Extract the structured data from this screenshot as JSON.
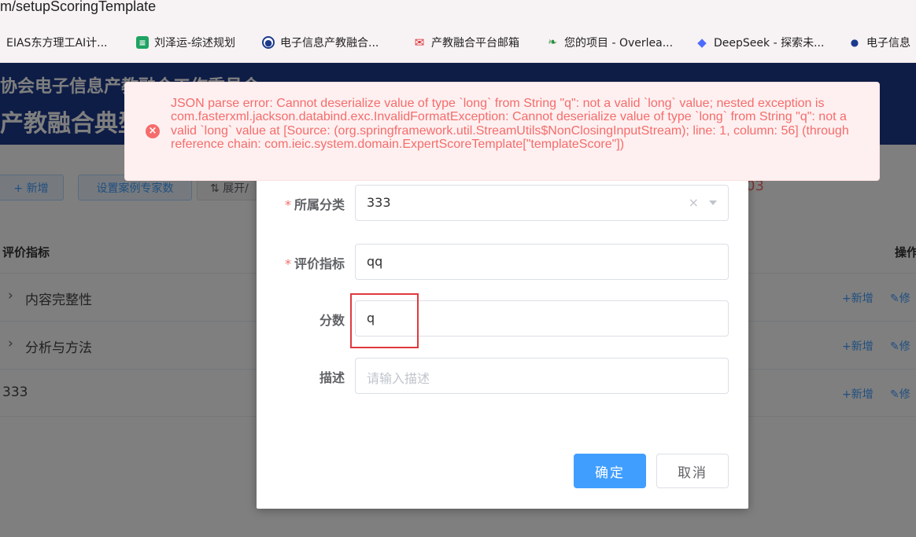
{
  "browser": {
    "url": "m/setupScoringTemplate",
    "bookmarks": [
      {
        "label": "EIAS东方理工AI计...",
        "icon": "page-icon"
      },
      {
        "label": "刘泽运-综述规划",
        "icon": "sheets-icon"
      },
      {
        "label": "电子信息产教融合...",
        "icon": "emblem-icon"
      },
      {
        "label": "产教融合平台邮箱",
        "icon": "mail-icon"
      },
      {
        "label": "您的项目 - Overlea...",
        "icon": "overleaf-icon"
      },
      {
        "label": "DeepSeek - 探索未...",
        "icon": "deepseek-icon"
      },
      {
        "label": "电子信息",
        "icon": "emblem-icon"
      }
    ]
  },
  "banner": {
    "line1": "协会电子信息产教融合工作委员会",
    "line2": "产教融合典型"
  },
  "toolbar": {
    "add_label": "+ 新增",
    "set_experts_label": "设置案例专家数",
    "expand_label": "⇅ 展开/",
    "partial_red": "03"
  },
  "table": {
    "col_indicator": "评价指标",
    "col_ops": "操作",
    "rows": [
      {
        "name": "内容完整性",
        "expandable": true
      },
      {
        "name": "分析与方法",
        "expandable": true
      },
      {
        "name": "333",
        "expandable": false
      }
    ],
    "op_add": "+新增",
    "op_edit": "✎修"
  },
  "dialog": {
    "category_label": "所属分类",
    "category_value": "333",
    "indicator_label": "评价指标",
    "indicator_value": "qq",
    "score_label": "分数",
    "score_value": "q",
    "desc_label": "描述",
    "desc_placeholder": "请输入描述",
    "confirm_label": "确定",
    "cancel_label": "取消",
    "required_mark": "*"
  },
  "toast": {
    "type": "error",
    "message": "JSON parse error: Cannot deserialize value of type `long` from String \"q\": not a valid `long` value; nested exception is com.fasterxml.jackson.databind.exc.InvalidFormatException: Cannot deserialize value of type `long` from String \"q\": not a valid `long` value at [Source: (org.springframework.util.StreamUtils$NonClosingInputStream); line: 1, column: 56] (through reference chain: com.ieic.system.domain.ExpertScoreTemplate[\"templateScore\"])"
  },
  "colors": {
    "primary": "#409eff",
    "danger": "#f56c6c",
    "banner": "#1c3a8c",
    "highlight_box": "#e0393e"
  }
}
